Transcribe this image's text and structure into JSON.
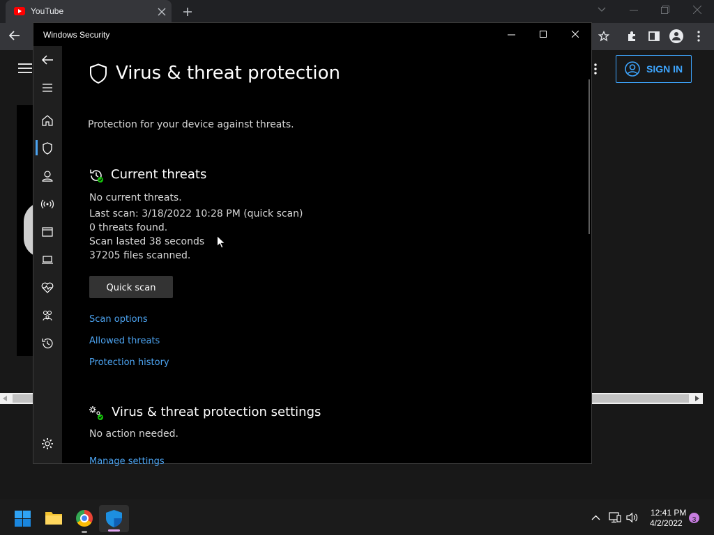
{
  "browser": {
    "tab_title": "YouTube",
    "sign_in_label": "SIGN IN"
  },
  "window": {
    "title": "Windows Security"
  },
  "page": {
    "title": "Virus & threat protection",
    "subtitle": "Protection for your device against threats."
  },
  "current_threats": {
    "heading": "Current threats",
    "status": "No current threats.",
    "last_scan": "Last scan: 3/18/2022 10:28 PM (quick scan)",
    "threats_found": "0 threats found.",
    "scan_duration": "Scan lasted 38 seconds",
    "files_scanned": "37205 files scanned.",
    "quick_scan_label": "Quick scan",
    "links": {
      "scan_options": "Scan options",
      "allowed_threats": "Allowed threats",
      "protection_history": "Protection history"
    }
  },
  "settings_section": {
    "heading": "Virus & threat protection settings",
    "status": "No action needed.",
    "manage_link": "Manage settings"
  },
  "nav_items": [
    "home-icon",
    "shield-icon",
    "account-icon",
    "network-icon",
    "app-browser-icon",
    "device-security-icon",
    "health-icon",
    "family-icon",
    "history-icon",
    "settings-icon"
  ],
  "taskbar": {
    "time": "12:41 PM",
    "date": "4/2/2022",
    "notification_count": "3"
  },
  "colors": {
    "accent": "#4ca3f0",
    "ok": "#16c60c",
    "youtube_red": "#ff0000"
  }
}
